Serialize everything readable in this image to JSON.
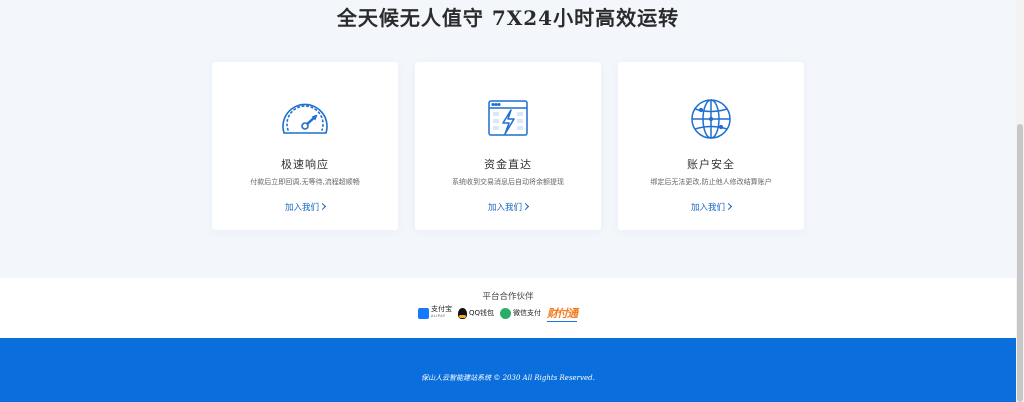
{
  "features": {
    "heading": "全天候无人值守 7X24小时高效运转",
    "cards": [
      {
        "icon": "speedometer-icon",
        "title": "极速响应",
        "desc": "付款后立即回调,无等待,流程超顺畅",
        "link": "加入我们"
      },
      {
        "icon": "lightning-window-icon",
        "title": "资金直达",
        "desc": "系统收到交易消息后自动将余额提现",
        "link": "加入我们"
      },
      {
        "icon": "globe-icon",
        "title": "账户安全",
        "desc": "绑定后无法更改,防止他人修改结算账户",
        "link": "加入我们"
      }
    ]
  },
  "partners": {
    "title": "平台合作伙伴",
    "logos": {
      "alipay": "支付宝",
      "alipay_sub": "ALIPAY",
      "qq": "QQ钱包",
      "wechat": "微信支付",
      "tenpay": "财付通"
    }
  },
  "footer": {
    "copyright": "保山人云智能建站系统  © 2030 All Rights Reserved."
  },
  "colors": {
    "accent": "#1565c0",
    "footer_bg": "#0a6fdc",
    "section_bg": "#f3f7fc"
  }
}
